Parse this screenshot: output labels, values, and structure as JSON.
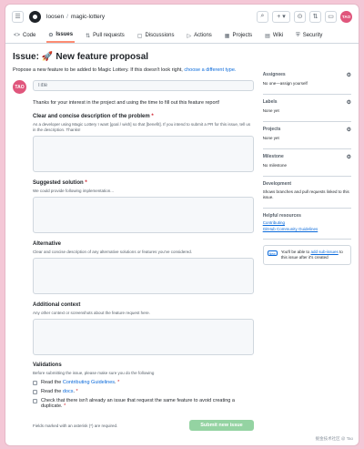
{
  "header": {
    "owner": "loosen",
    "separator": "/",
    "repo": "magic-lottery",
    "plus": "+ ▾",
    "avatar_initials": "TAO"
  },
  "tabs": [
    {
      "label": "Code",
      "icon": "<>"
    },
    {
      "label": "Issues",
      "icon": "⊙"
    },
    {
      "label": "Pull requests",
      "icon": "⇅"
    },
    {
      "label": "Discussions",
      "icon": "▢"
    },
    {
      "label": "Actions",
      "icon": "▷"
    },
    {
      "label": "Projects",
      "icon": "▦"
    },
    {
      "label": "Wiki",
      "icon": "▤"
    },
    {
      "label": "Security",
      "icon": "⛨"
    }
  ],
  "page": {
    "title_prefix": "Issue:",
    "title_emoji": "🚀",
    "title": "New feature proposal",
    "subline": "Propose a new feature to be added to Magic Lottery. If this doesn't look right,",
    "subline_link": "choose a different type."
  },
  "form": {
    "avatar_initials": "TAO",
    "title_placeholder": "Title",
    "intro": "Thanks for your interest in the project and using the time to fill out this feature report!",
    "fields": [
      {
        "label": "Clear and concise description of the problem",
        "required": "*",
        "desc": "As a developer using Magic Lottery I want [goal / wish] so that [benefit]. If you intend to submit a PR for this issue, tell us in the description. Thanks!"
      },
      {
        "label": "Suggested solution",
        "required": "*",
        "desc": "We could provide following implementation..."
      },
      {
        "label": "Alternative",
        "required": "",
        "desc": "Clear and concise description of any alternative solutions or features you've considered."
      },
      {
        "label": "Additional context",
        "required": "",
        "desc": "Any other context or screenshots about the feature request here."
      }
    ],
    "validations_title": "Validations",
    "validations_desc": "Before submitting the issue, please make sure you do the following",
    "checks": [
      {
        "pre": "Read the",
        "link": "Contributing Guidelines",
        "post": ".",
        "req": "*"
      },
      {
        "pre": "Read the",
        "link": "docs",
        "post": ".",
        "req": "*"
      },
      {
        "pre": "Check that there isn't already an issue that request the same feature to avoid creating a duplicate.",
        "link": "",
        "post": "",
        "req": "*"
      }
    ],
    "footer_note": "Fields marked with an asterisk (*) are required.",
    "submit_label": "Submit new issue"
  },
  "sidebar": {
    "sections": [
      {
        "head": "Assignees",
        "value": "No one—assign yourself"
      },
      {
        "head": "Labels",
        "value": "None yet"
      },
      {
        "head": "Projects",
        "value": "None yet"
      },
      {
        "head": "Milestone",
        "value": "No milestone"
      }
    ],
    "development_head": "Development",
    "development_value": "Shows branches and pull requests linked to this issue.",
    "helpful_head": "Helpful resources",
    "helpful_links": [
      "Contributing",
      "GitHub Community Guidelines"
    ],
    "tip_badge": "New",
    "tip_pre": "You'll be able to",
    "tip_link": "add sub-issues",
    "tip_post": "to this issue after it's created"
  },
  "watermark": "掘金技术社区 @ Tao"
}
